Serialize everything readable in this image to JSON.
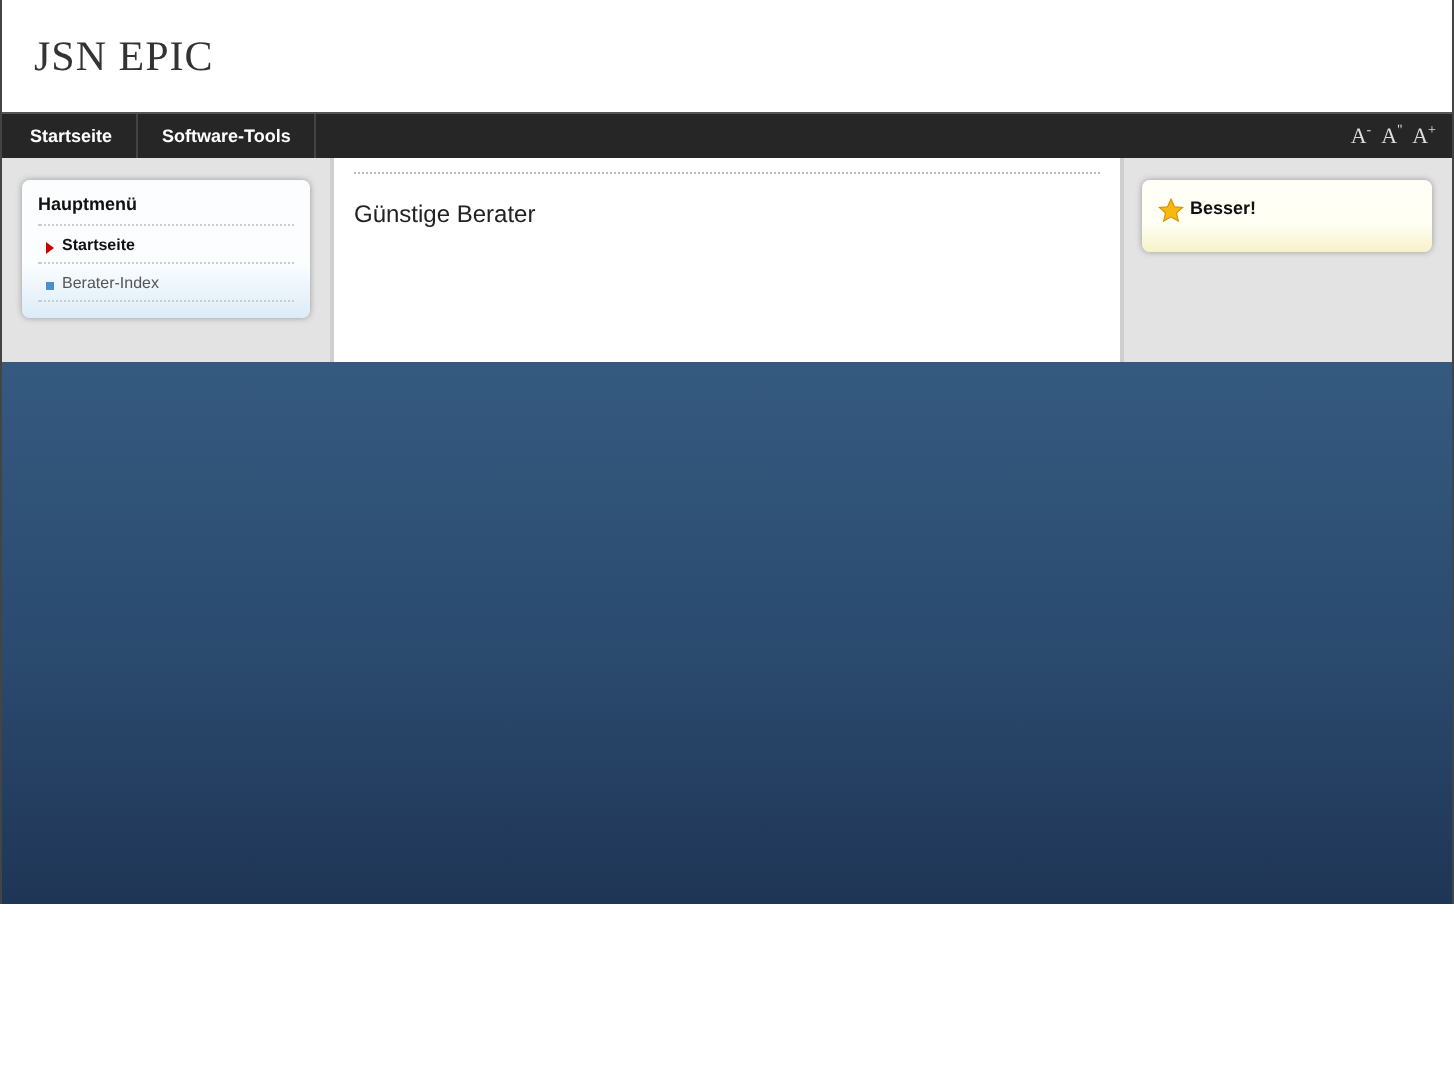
{
  "header": {
    "logo": "JSN EPIC"
  },
  "nav": {
    "items": [
      {
        "label": "Startseite",
        "selected": false
      },
      {
        "label": "Software-Tools",
        "selected": false
      }
    ],
    "font_sizes": [
      "A$^{-}$",
      "A$^{''}$",
      "A$^{+}$"
    ]
  },
  "left_module": {
    "title": "Hauptmenü",
    "items": [
      {
        "label": "Startseite",
        "selected": true
      },
      {
        "label": "Berater-Index",
        "selected": false
      }
    ]
  },
  "content": {
    "heading": "Günstige Berater"
  },
  "right_module": {
    "title": "Besser!"
  }
}
